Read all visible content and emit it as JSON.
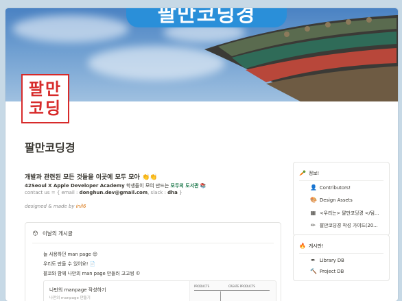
{
  "banner": {
    "title": "팔만코딩경"
  },
  "logo": {
    "line1": "팔만",
    "line2": "코딩"
  },
  "page": {
    "title": "팔만코딩경"
  },
  "intro": {
    "title": "개발과 관련된 모든 것들을 이곳에 모두 모아 👏👏",
    "org": "42Seoul X Apple Developer Academy",
    "middle": " 학생들이 모여 만드는 ",
    "library": "모두의 도서관",
    "contact_prefix": "contact us = { email : ",
    "email": "donghun.dev@gmail.com",
    "slack_prefix": ", slack : ",
    "slack": "dha",
    "contact_suffix": " }",
    "made_by_prefix": "designed & made by ",
    "author": "inil6"
  },
  "today": {
    "icon": "smiley-icon",
    "title": "이날의 게시글",
    "posts": [
      "늘 사용하던 man page 😊",
      "우리도 만들 수 있어요! 📄",
      "팔코와 함께 나만의 man page 만들러 고고씽 ©"
    ],
    "card_title": "나만의 manpage 작성하기",
    "card_sub": "나만의 manpage 만들기",
    "thumb_labels": [
      "PRODUCTS",
      "CREATE PRODUCTS"
    ]
  },
  "info": {
    "icon": "carrot-icon",
    "title": "정보!",
    "items": [
      {
        "icon": "person-icon",
        "label": "Contributors!"
      },
      {
        "icon": "palette-icon",
        "label": "Design Assets"
      },
      {
        "icon": "grid-icon",
        "label": "<우리는> 팔만코딩경 </팀..."
      },
      {
        "icon": "pencil-icon",
        "label": "팔만코딩경 작성 가이드(20..."
      }
    ]
  },
  "board": {
    "icon": "fire-icon",
    "title": "게시판!",
    "items": [
      {
        "icon": "quill-icon",
        "label": "Library DB"
      },
      {
        "icon": "hammer-icon",
        "label": "Project DB"
      }
    ]
  }
}
